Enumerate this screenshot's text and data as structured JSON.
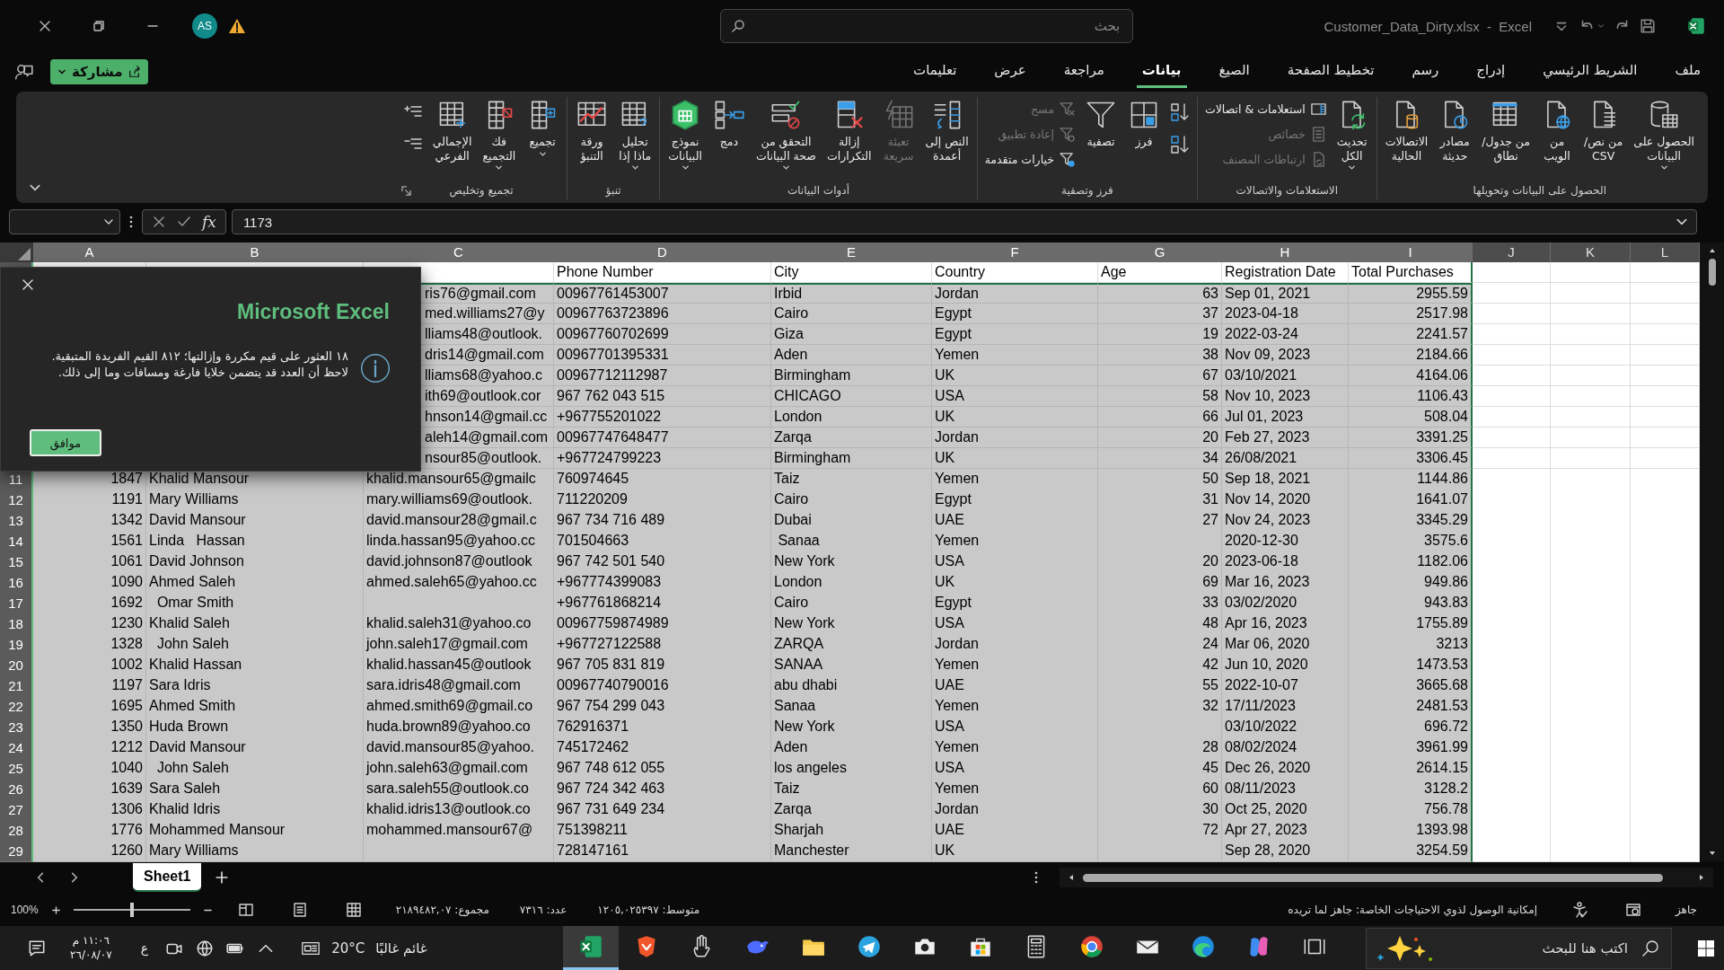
{
  "titlebar": {
    "avatar": "AS",
    "search_placeholder": "بحث",
    "title": "Customer_Data_Dirty.xlsx  -  Excel"
  },
  "share": {
    "label": "مشاركة"
  },
  "tabs": [
    {
      "label": "ملف",
      "selected": false
    },
    {
      "label": "الشريط الرئيسي",
      "selected": false
    },
    {
      "label": "إدراج",
      "selected": false
    },
    {
      "label": "رسم",
      "selected": false
    },
    {
      "label": "تخطيط الصفحة",
      "selected": false
    },
    {
      "label": "الصيغ",
      "selected": false
    },
    {
      "label": "بيانات",
      "selected": true
    },
    {
      "label": "مراجعة",
      "selected": false
    },
    {
      "label": "عرض",
      "selected": false
    },
    {
      "label": "تعليمات",
      "selected": false
    }
  ],
  "ribbon": {
    "groups": [
      {
        "label": "الحصول على البيانات وتحويلها",
        "items": [
          {
            "kind": "large",
            "label": "الحصول على\nالبيانات",
            "dropdown": true,
            "disabled": false
          },
          {
            "kind": "large",
            "label": "من نص/\nCSV",
            "dropdown": false,
            "disabled": false
          },
          {
            "kind": "large",
            "label": "من\nالويب",
            "dropdown": false,
            "disabled": false
          },
          {
            "kind": "large",
            "label": "من جدول/\nنطاق",
            "dropdown": false,
            "disabled": false
          },
          {
            "kind": "large",
            "label": "مصادر\nحديثة",
            "dropdown": false,
            "disabled": false
          },
          {
            "kind": "large",
            "label": "الاتصالات\nالحالية",
            "dropdown": false,
            "disabled": false
          }
        ]
      },
      {
        "label": "الاستعلامات والاتصالات",
        "items": [
          {
            "kind": "large",
            "label": "تحديث\nالكل",
            "dropdown": true,
            "disabled": false
          },
          {
            "kind": "stack",
            "items": [
              {
                "label": "استعلامات & اتصالات",
                "disabled": false
              },
              {
                "label": "خصائص",
                "disabled": true
              },
              {
                "label": "ارتباطات المصنف",
                "disabled": true
              }
            ]
          }
        ]
      },
      {
        "label": "فرز وتصفية",
        "items": [
          {
            "kind": "icons"
          },
          {
            "kind": "large",
            "label": "فرز",
            "dropdown": false,
            "disabled": false
          },
          {
            "kind": "large",
            "label": "تصفية",
            "dropdown": false,
            "disabled": false
          },
          {
            "kind": "stack",
            "items": [
              {
                "label": "مسح",
                "disabled": true
              },
              {
                "label": "إعادة تطبيق",
                "disabled": true
              },
              {
                "label": "خيارات متقدمة",
                "disabled": false
              }
            ]
          }
        ]
      },
      {
        "label": "أدوات البيانات",
        "items": [
          {
            "kind": "large",
            "label": "النص إلى\nأعمدة",
            "dropdown": false,
            "disabled": false
          },
          {
            "kind": "large",
            "label": "تعبئة\nسريعة",
            "dropdown": false,
            "disabled": true
          },
          {
            "kind": "large",
            "label": "إزالة\nالتكرارات",
            "dropdown": false,
            "disabled": false
          },
          {
            "kind": "large",
            "label": "التحقق من\nصحة البيانات",
            "dropdown": true,
            "disabled": false
          },
          {
            "kind": "large",
            "label": "دمج",
            "dropdown": false,
            "disabled": false
          },
          {
            "kind": "large",
            "label": "نموذج\nالبيانات",
            "dropdown": true,
            "disabled": false
          }
        ]
      },
      {
        "label": "تنبؤ",
        "items": [
          {
            "kind": "large",
            "label": "تحليل\nماذا إذا",
            "dropdown": true,
            "disabled": false
          },
          {
            "kind": "large",
            "label": "ورقة\nالتنبؤ",
            "dropdown": false,
            "disabled": false
          }
        ]
      },
      {
        "label": "تجميع وتخليص",
        "launcher": true,
        "items": [
          {
            "kind": "large",
            "label": "تجميع",
            "dropdown": true,
            "disabled": false
          },
          {
            "kind": "large",
            "label": "فك\nالتجميع",
            "dropdown": true,
            "disabled": false
          },
          {
            "kind": "large",
            "label": "الإجمالي\nالفرعي",
            "dropdown": false,
            "disabled": false
          },
          {
            "kind": "icons"
          }
        ]
      }
    ]
  },
  "formula": {
    "fx": "fx",
    "value": "1173"
  },
  "grid": {
    "columns": [
      "A",
      "B",
      "C",
      "D",
      "E",
      "F",
      "G",
      "H",
      "I",
      "J",
      "K",
      "L"
    ],
    "rows": [
      {
        "number": null,
        "cells": [
          null,
          null,
          null,
          "Phone Number",
          "City",
          "Country",
          "Age",
          "Registration Date",
          "Total Purchases"
        ]
      },
      {
        "number": null,
        "cells": [
          null,
          null,
          "ris76@gmail.com",
          "00967761453007",
          "Irbid",
          "Jordan",
          "63",
          "Sep 01, 2021",
          "2955.59"
        ]
      },
      {
        "number": null,
        "cells": [
          null,
          null,
          "med.williams27@y",
          "00967763723896",
          "Cairo",
          "Egypt",
          "37",
          "2023-04-18",
          "2517.98"
        ]
      },
      {
        "number": null,
        "cells": [
          null,
          null,
          "lliams48@outlook.",
          "00967760702699",
          "Giza",
          "Egypt",
          "19",
          "2022-03-24",
          "2241.57"
        ]
      },
      {
        "number": null,
        "cells": [
          null,
          null,
          "dris14@gmail.com",
          "00967701395331",
          "Aden",
          "Yemen",
          "38",
          "Nov 09, 2023",
          "2184.66"
        ]
      },
      {
        "number": null,
        "cells": [
          null,
          null,
          "lliams68@yahoo.c",
          "00967712112987",
          "Birmingham",
          "UK",
          "67",
          "03/10/2021",
          "4164.06"
        ]
      },
      {
        "number": null,
        "cells": [
          null,
          null,
          "ith69@outlook.cor",
          "967 762 043 515",
          "CHICAGO",
          "USA",
          "58",
          "Nov 10, 2023",
          "1106.43"
        ]
      },
      {
        "number": null,
        "cells": [
          null,
          null,
          "hnson14@gmail.cc",
          "+967755201022",
          "London",
          "UK",
          "66",
          "Jul 01, 2023",
          "508.04"
        ]
      },
      {
        "number": null,
        "cells": [
          null,
          null,
          "aleh14@gmail.com",
          "00967747648477",
          "Zarqa",
          "Jordan",
          "20",
          "Feb 27, 2023",
          "3391.25"
        ]
      },
      {
        "number": null,
        "cells": [
          null,
          null,
          "nsour85@outlook.",
          "+967724799223",
          "Birmingham",
          "UK",
          "34",
          "26/08/2021",
          "3306.45"
        ]
      },
      {
        "number": "11",
        "cells": [
          "1847",
          "Khalid Mansour",
          "khalid.mansour65@gmailc",
          "760974645",
          "Taiz",
          "Yemen",
          "50",
          "Sep 18, 2021",
          "1144.86"
        ]
      },
      {
        "number": "12",
        "cells": [
          "1191",
          "Mary Williams",
          "mary.williams69@outlook.",
          "711220209",
          "Cairo",
          "Egypt",
          "31",
          "Nov 14, 2020",
          "1641.07"
        ]
      },
      {
        "number": "13",
        "cells": [
          "1342",
          "David Mansour",
          "david.mansour28@gmail.c",
          "967 734 716 489",
          "Dubai",
          "UAE",
          "27",
          "Nov 24, 2023",
          "3345.29"
        ]
      },
      {
        "number": "14",
        "cells": [
          "1561",
          "Linda   Hassan",
          "linda.hassan95@yahoo.cc",
          "701504663",
          " Sanaa",
          "Yemen",
          null,
          "2020-12-30",
          "3575.6"
        ]
      },
      {
        "number": "15",
        "cells": [
          "1061",
          "David Johnson",
          "david.johnson87@outlook",
          "967 742 501 540",
          "New York",
          "USA",
          "20",
          "2023-06-18",
          "1182.06"
        ]
      },
      {
        "number": "16",
        "cells": [
          "1090",
          "Ahmed Saleh",
          "ahmed.saleh65@yahoo.cc",
          "+967774399083",
          "London",
          "UK",
          "69",
          "Mar 16, 2023",
          "949.86"
        ]
      },
      {
        "number": "17",
        "cells": [
          "1692",
          "  Omar Smith",
          null,
          "+967761868214",
          "Cairo",
          "Egypt",
          "33",
          "03/02/2020",
          "943.83"
        ]
      },
      {
        "number": "18",
        "cells": [
          "1230",
          "Khalid Saleh",
          "khalid.saleh31@yahoo.co",
          "00967759874989",
          "New York",
          "USA",
          "48",
          "Apr 16, 2023",
          "1755.89"
        ]
      },
      {
        "number": "19",
        "cells": [
          "1328",
          "  John Saleh",
          "john.saleh17@gmail.com",
          "+967727122588",
          "ZARQA",
          "Jordan",
          "24",
          "Mar 06, 2020",
          "3213"
        ]
      },
      {
        "number": "20",
        "cells": [
          "1002",
          "Khalid Hassan",
          "khalid.hassan45@outlook",
          "967 705 831 819",
          "SANAA",
          "Yemen",
          "42",
          "Jun 10, 2020",
          "1473.53"
        ]
      },
      {
        "number": "21",
        "cells": [
          "1197",
          "Sara Idris",
          "sara.idris48@gmail.com",
          "00967740790016",
          "abu dhabi",
          "UAE",
          "55",
          "2022-10-07",
          "3665.68"
        ]
      },
      {
        "number": "22",
        "cells": [
          "1695",
          "Ahmed Smith",
          "ahmed.smith69@gmail.co",
          "967 754 299 043",
          "Sanaa",
          "Yemen",
          "32",
          "17/11/2023",
          "2481.53"
        ]
      },
      {
        "number": "23",
        "cells": [
          "1350",
          "Huda Brown",
          "huda.brown89@yahoo.co",
          "762916371",
          "New York",
          "USA",
          null,
          "03/10/2022",
          "696.72"
        ]
      },
      {
        "number": "24",
        "cells": [
          "1212",
          "David Mansour",
          "david.mansour85@yahoo.",
          "745172462",
          "Aden",
          "Yemen",
          "28",
          "08/02/2024",
          "3961.99"
        ]
      },
      {
        "number": "25",
        "cells": [
          "1040",
          "  John Saleh",
          "john.saleh63@gmail.com",
          "967 748 612 055",
          "los angeles",
          "USA",
          "45",
          "Dec 26, 2020",
          "2614.15"
        ]
      },
      {
        "number": "26",
        "cells": [
          "1639",
          "Sara Saleh",
          "sara.saleh55@outlook.co",
          "967 724 342 463",
          "Taiz",
          "Yemen",
          "60",
          "08/11/2023",
          "3128.2"
        ]
      },
      {
        "number": "27",
        "cells": [
          "1306",
          "Khalid Idris",
          "khalid.idris13@outlook.co",
          "967 731 649 234",
          "Zarqa",
          "Jordan",
          "30",
          "Oct 25, 2020",
          "756.78"
        ]
      },
      {
        "number": "28",
        "cells": [
          "1776",
          "Mohammed Mansour",
          "mohammed.mansour67@",
          "751398211",
          "Sharjah",
          "UAE",
          "72",
          "Apr 27, 2023",
          "1393.98"
        ]
      },
      {
        "number": "29",
        "cells": [
          "1260",
          "Mary Williams",
          null,
          "728147161",
          "Manchester",
          "UK",
          null,
          "Sep 28, 2020",
          "3254.59"
        ]
      }
    ]
  },
  "dialog": {
    "title": "Microsoft Excel",
    "message": "١٨ العثور على قيم مكررة وإزالتها؛ ٨١٢ القيم الفريدة المتبقية. لاحظ أن العدد قد يتضمن خلايا فارغة ومسافات وما إلى ذلك.",
    "ok": "موافق"
  },
  "sheet_tabs": [
    {
      "label": "Sheet1",
      "selected": true
    }
  ],
  "status_bar": {
    "zoom": "100%",
    "zoom_slider": {
      "level": 0.5
    },
    "sum": "مجموع: ٢١٨٩٤٨٢,٠٧",
    "count": "عدد: ٧٣١٦",
    "average": "متوسط: ١٢٠٥,٠٢٥٣٩٧",
    "accessibility": "إمكانية الوصول لذوي الاحتياجات الخاصة: جاهز لما تريده",
    "ready": "جاهز"
  },
  "taskbar": {
    "time": "١١:٠٦ م",
    "date": "٢٦/٠٨/٠٧",
    "language": "ع",
    "weather": {
      "temperature": "20°C",
      "condition": "غائم غالبًا"
    },
    "apps": [
      {
        "selected": true
      },
      {
        "selected": false
      },
      {
        "selected": false
      },
      {
        "selected": false
      },
      {
        "selected": false
      },
      {
        "selected": false
      },
      {
        "selected": false
      },
      {
        "selected": false
      },
      {
        "selected": false
      },
      {
        "selected": false
      },
      {
        "selected": false
      },
      {
        "selected": false
      },
      {
        "selected": false
      },
      {
        "selected": false
      }
    ],
    "search_placeholder": "اكتب هنا للبحث"
  }
}
